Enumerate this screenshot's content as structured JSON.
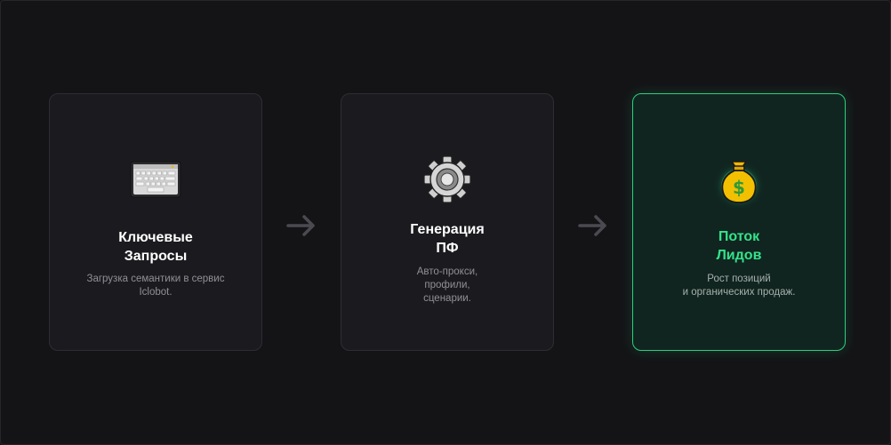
{
  "cards": [
    {
      "title": "Ключевые\nЗапросы",
      "description": "Загрузка семантики в сервис\nIclobot.",
      "icon": "keyboard-icon"
    },
    {
      "title": "Генерация\nПФ",
      "description": "Авто-прокси,\nпрофили,\nсценарии.",
      "icon": "gear-icon"
    },
    {
      "title": "Поток\nЛидов",
      "description": "Рост позиций\nи органических продаж.",
      "icon": "money-bag-icon"
    }
  ],
  "arrows": [
    "arrow-right-icon",
    "arrow-right-icon"
  ],
  "colors": {
    "background": "#141417",
    "card": "#1b1b1f",
    "accent": "#33e38a",
    "highlight_card": "#112520"
  }
}
